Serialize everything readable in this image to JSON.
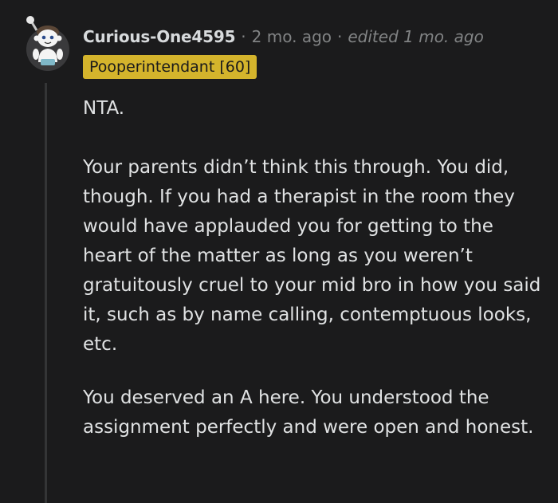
{
  "comment": {
    "username": "Curious-One4595",
    "separator": "·",
    "timestamp": "2 mo. ago",
    "edited": "edited 1 mo. ago",
    "flair": "Pooperintendant [60]",
    "flair_color": "#d4b42c",
    "avatar_icon": "snoo-avatar-icon",
    "paragraphs": [
      "NTA.",
      "Your parents didn’t think this through. You did, though. If you had a therapist in the room they would have applauded you for getting to the heart of the matter as long as you weren’t gratuitously cruel to your mid bro in how you said it, such as by name calling, contemptuous looks, etc.",
      "You deserved an A here. You understood the assignment perfectly and were open and honest."
    ]
  }
}
